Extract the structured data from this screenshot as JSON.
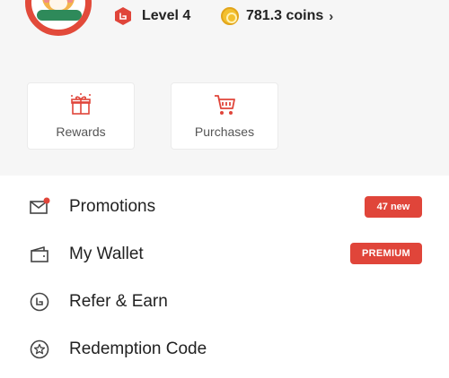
{
  "header": {
    "level_label": "Level 4",
    "coins_label": "781.3 coins",
    "chevron_glyph": "›"
  },
  "cards": [
    {
      "label": "Rewards",
      "icon": "gift-icon"
    },
    {
      "label": "Purchases",
      "icon": "cart-icon"
    }
  ],
  "menu": [
    {
      "label": "Promotions",
      "icon": "mail-icon",
      "badge": "47 new",
      "has_dot": true
    },
    {
      "label": "My Wallet",
      "icon": "wallet-icon",
      "badge": "PREMIUM"
    },
    {
      "label": "Refer & Earn",
      "icon": "refer-icon"
    },
    {
      "label": "Redemption Code",
      "icon": "star-badge-icon"
    }
  ],
  "colors": {
    "accent": "#e0453a",
    "coin": "#f3c02f",
    "top_background": "#f6f6f6"
  }
}
